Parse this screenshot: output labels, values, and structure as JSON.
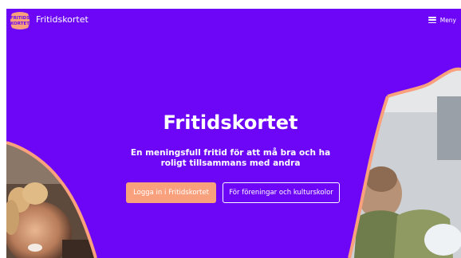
{
  "nav": {
    "logo_text": "FRITIDS KORTET",
    "brand": "Fritidskortet",
    "menu_label": "Meny"
  },
  "hero": {
    "title": "Fritidskortet",
    "subtitle": "En meningsfull fritid för att må bra och ha roligt tillsammans med andra"
  },
  "actions": {
    "primary_label": "Logga in i Fritidskortet",
    "secondary_label": "För föreningar och kulturskolor"
  },
  "colors": {
    "background": "#6d06f6",
    "accent": "#f9a07c",
    "text": "#ffffff"
  },
  "icons": [
    "logo-icon",
    "hamburger-menu-icon"
  ]
}
